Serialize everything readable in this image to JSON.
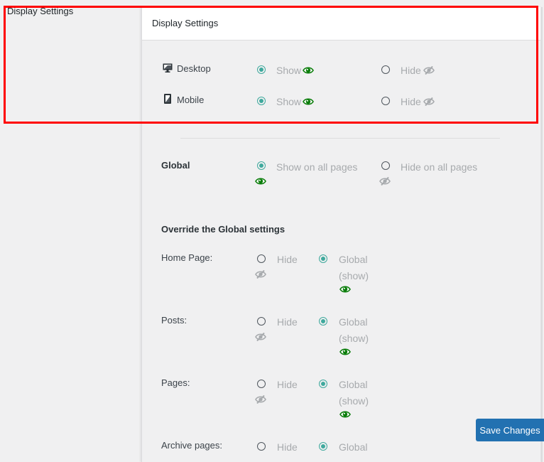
{
  "section_label": "Display Settings",
  "panel": {
    "title": "Display Settings"
  },
  "devices": [
    {
      "label": "Desktop",
      "icon": "desktop-icon",
      "show_label": "Show",
      "hide_label": "Hide",
      "selected": "show"
    },
    {
      "label": "Mobile",
      "icon": "mobile-icon",
      "show_label": "Show",
      "hide_label": "Hide",
      "selected": "show"
    }
  ],
  "global": {
    "label": "Global",
    "show_label": "Show on all pages",
    "hide_label": "Hide on all pages",
    "selected": "show"
  },
  "override": {
    "heading": "Override the Global settings",
    "rows": [
      {
        "label": "Home Page:",
        "hide_label": "Hide",
        "global_label": "Global",
        "global_state": "(show)",
        "selected": "global"
      },
      {
        "label": "Posts:",
        "hide_label": "Hide",
        "global_label": "Global",
        "global_state": "(show)",
        "selected": "global"
      },
      {
        "label": "Pages:",
        "hide_label": "Hide",
        "global_label": "Global",
        "global_state": "(show)",
        "selected": "global"
      },
      {
        "label": "Archive pages:",
        "hide_label": "Hide",
        "global_label": "Global",
        "global_state": "",
        "selected": "global"
      }
    ]
  },
  "actions": {
    "save_label": "Save Changes"
  },
  "colors": {
    "accent": "#3fa99d",
    "eye_show": "#0a7d0a",
    "eye_hide": "#a7aaad",
    "primary_button": "#2271b1",
    "highlight": "#ff0000"
  }
}
